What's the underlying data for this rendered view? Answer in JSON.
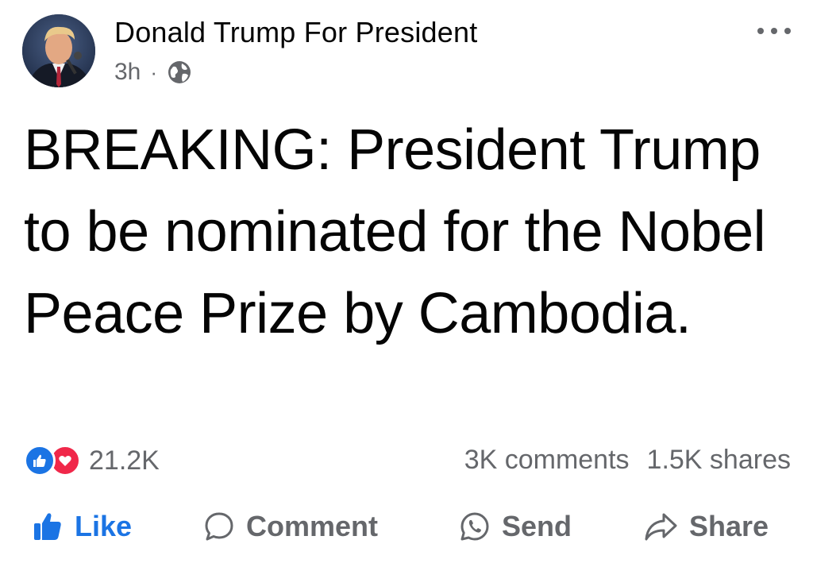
{
  "post": {
    "author": "Donald Trump For President",
    "time": "3h",
    "separator": "·",
    "audience_icon": "globe-icon",
    "text": "BREAKING: President Trump to be nominated for the Nobel Peace Prize by Cambodia."
  },
  "stats": {
    "reaction_icons": [
      "like-reaction-icon",
      "love-reaction-icon"
    ],
    "reaction_count": "21.2K",
    "comments": "3K comments",
    "shares": "1.5K shares"
  },
  "actions": {
    "like": "Like",
    "comment": "Comment",
    "send": "Send",
    "share": "Share"
  },
  "colors": {
    "accent": "#1b74e4",
    "love": "#f0284a",
    "secondary_text": "#65676b",
    "primary_text": "#050505"
  }
}
